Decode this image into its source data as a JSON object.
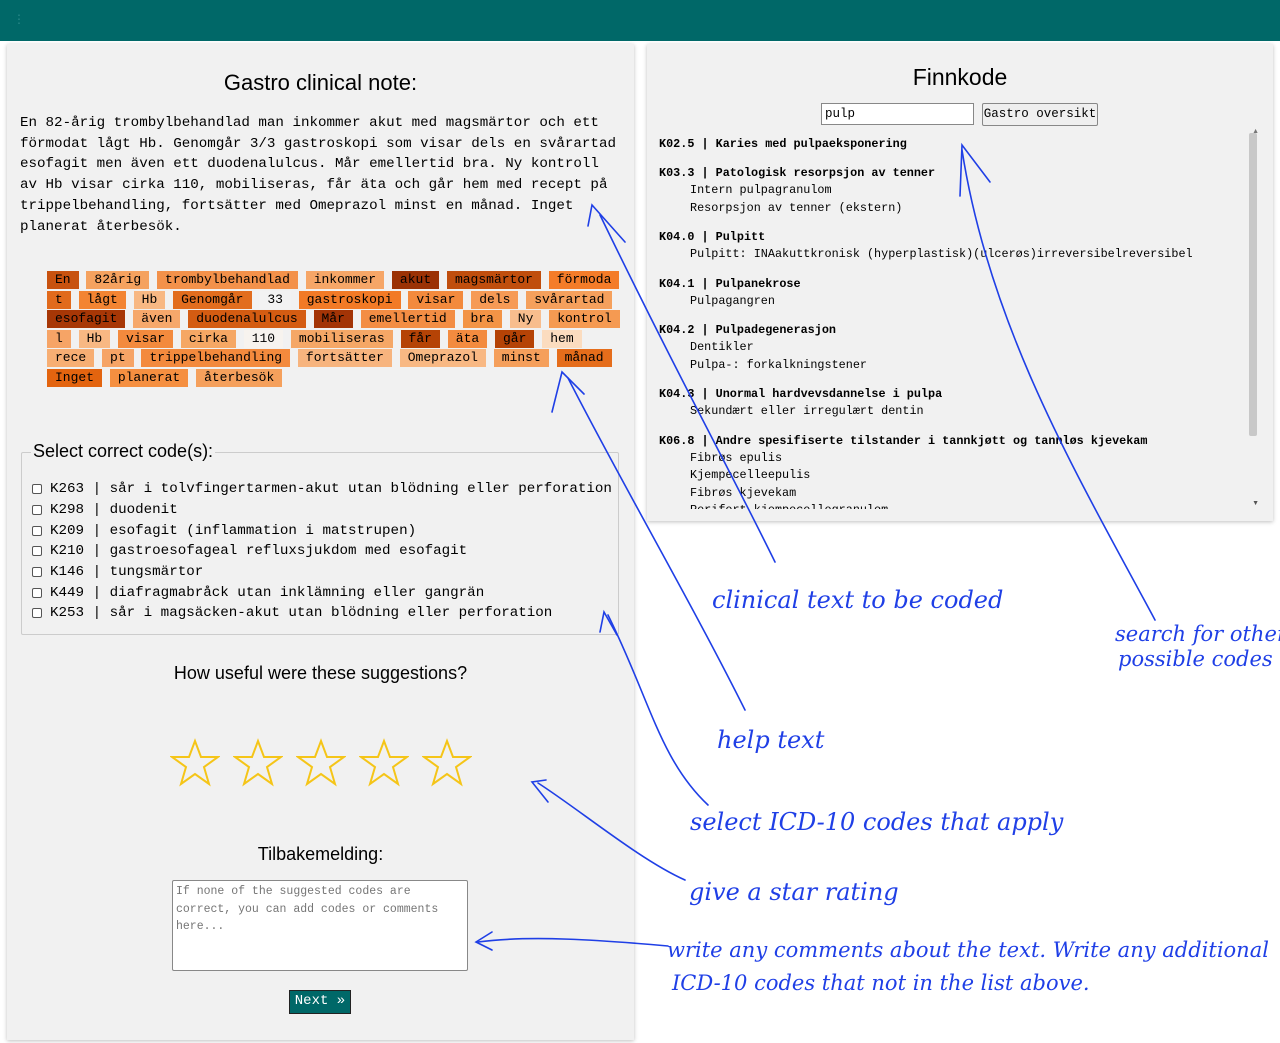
{
  "topbar": {
    "menu_glyph": "⋮"
  },
  "note": {
    "title": "Gastro clinical note:",
    "text": "En 82-årig trombylbehandlad man inkommer akut med magsmärtor och ett förmodat lågt Hb. Genomgår 3/3 gastroskopi som visar dels en svårartad esofagit men även ett duodenalulcus. Mår emellertid bra. Ny kontroll av Hb visar cirka 110, mobiliseras, får äta och går hem med recept på trippelbehandling, fortsätter med Omeprazol minst en månad. Inget planerat återbesök."
  },
  "tokens": [
    {
      "t": "En",
      "c": "#c8520f"
    },
    {
      "t": "82årig",
      "c": "#f5a25f"
    },
    {
      "t": "trombylbehandlad",
      "c": "#f3914a"
    },
    {
      "t": "inkommer",
      "c": "#f6a667"
    },
    {
      "t": "akut",
      "c": "#9b3205"
    },
    {
      "t": "magsmärtor",
      "c": "#c04e0d"
    },
    {
      "t": "förmoda",
      "c": "#f47c29"
    },
    {
      "t": "t",
      "c": "#e16a1c"
    },
    {
      "t": "lågt",
      "c": "#f38432"
    },
    {
      "t": "Hb",
      "c": "#f8b883"
    },
    {
      "t": "Genomgår",
      "c": "#e26d1e"
    },
    {
      "t": "33",
      "c": "#f2f2f2"
    },
    {
      "t": "gastroskopi",
      "c": "#f27a26"
    },
    {
      "t": "visar",
      "c": "#f38a3d"
    },
    {
      "t": "dels",
      "c": "#f69a55"
    },
    {
      "t": "svårartad",
      "c": "#f5a05c"
    },
    {
      "t": "esofagit",
      "c": "#a73706"
    },
    {
      "t": "även",
      "c": "#f6a86b"
    },
    {
      "t": "duodenalulcus",
      "c": "#d45c12"
    },
    {
      "t": "Mår",
      "c": "#a33406"
    },
    {
      "t": "emellertid",
      "c": "#f38d44"
    },
    {
      "t": "bra",
      "c": "#f39446"
    },
    {
      "t": "Ny",
      "c": "#f8bd8d"
    },
    {
      "t": "kontrol",
      "c": "#f59a52"
    },
    {
      "t": "l",
      "c": "#f6a466"
    },
    {
      "t": "Hb",
      "c": "#f8b883"
    },
    {
      "t": "visar",
      "c": "#f38a3d"
    },
    {
      "t": "cirka",
      "c": "#f5a764"
    },
    {
      "t": "110",
      "c": "#f7f3ee"
    },
    {
      "t": "mobiliseras",
      "c": "#f5a766"
    },
    {
      "t": "får",
      "c": "#b54306"
    },
    {
      "t": "äta",
      "c": "#f38b3f"
    },
    {
      "t": "går",
      "c": "#b54306"
    },
    {
      "t": "hem",
      "c": "#fbdcbf"
    },
    {
      "t": "rece",
      "c": "#f7ae73"
    },
    {
      "t": "pt",
      "c": "#f6a466"
    },
    {
      "t": "trippelbehandling",
      "c": "#f38a3d"
    },
    {
      "t": "fortsätter",
      "c": "#f7b47e"
    },
    {
      "t": "Omeprazol",
      "c": "#f8b883"
    },
    {
      "t": "minst",
      "c": "#f59f5b"
    },
    {
      "t": "månad",
      "c": "#e56d1b"
    },
    {
      "t": "Inget",
      "c": "#e3640f"
    },
    {
      "t": "planerat",
      "c": "#f58f40"
    },
    {
      "t": "återbesök",
      "c": "#f5a05c"
    }
  ],
  "codes": {
    "legend": "Select correct code(s):",
    "items": [
      "K263 | sår i tolvfingertarmen-akut utan blödning eller perforation",
      "K298 | duodenit",
      "K209 | esofagit (inflammation i matstrupen)",
      "K210 | gastroesofageal refluxsjukdom med esofagit",
      "K146 | tungsmärtor",
      "K449 | diafragmabråck utan inklämning eller gangrän",
      "K253 | sår i magsäcken-akut utan blödning eller perforation"
    ]
  },
  "rating": {
    "title": "How useful were these suggestions?",
    "stars": 5,
    "selected": 0,
    "star_color": "#f5c518"
  },
  "feedback": {
    "title": "Tilbakemelding:",
    "placeholder": "If none of the suggested codes are correct, you can add codes or comments here..."
  },
  "next_label": "Next »",
  "finnkode": {
    "title": "Finnkode",
    "search_value": "pulp",
    "overview_label": "Gastro oversikt",
    "results": [
      {
        "head": "K02.5 | Karies med pulpaeksponering",
        "subs": []
      },
      {
        "head": "K03.3 | Patologisk resorpsjon av tenner",
        "subs": [
          "Intern pulpagranulom",
          "Resorpsjon av tenner (ekstern)"
        ]
      },
      {
        "head": "K04.0 | Pulpitt",
        "subs": [
          "Pulpitt: INAakuttkronisk (hyperplastisk)(ulcerøs)irreversibelreversibel"
        ]
      },
      {
        "head": "K04.1 | Pulpanekrose",
        "subs": [
          "Pulpagangren"
        ]
      },
      {
        "head": "K04.2 | Pulpadegenerasjon",
        "subs": [
          "Dentikler",
          "Pulpa-: forkalkningstener"
        ]
      },
      {
        "head": "K04.3 | Unormal hardvevsdannelse i pulpa",
        "subs": [
          "Sekundært eller irregulært dentin"
        ]
      },
      {
        "head": "K06.8 | Andre spesifiserte tilstander i tannkjøtt og tannløs kjevekam",
        "subs": [
          "Fibrøs epulis",
          "Kjempecelleepulis",
          "Fibrøs kjevekam",
          "Perifert kjempecellegranulom"
        ]
      }
    ]
  },
  "annotations": {
    "color": "#1f3fe6",
    "clinical_text": "clinical text to be coded",
    "search": [
      "search for other",
      "possible codes"
    ],
    "help_text": "help text",
    "select_codes": "select ICD-10 codes that apply",
    "star_rating": "give a star rating",
    "comments": [
      "write any comments about the text. Write any additional",
      "ICD-10 codes that not in the list above."
    ]
  }
}
